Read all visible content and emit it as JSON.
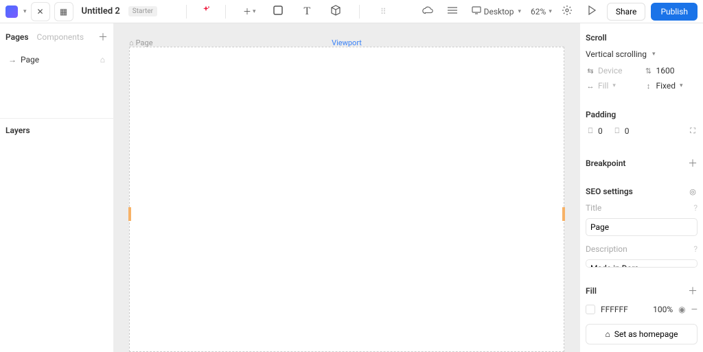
{
  "header": {
    "title": "Untitled 2",
    "plan_tag": "Starter",
    "device_label": "Desktop",
    "zoom": "62%",
    "share": "Share",
    "publish": "Publish"
  },
  "left": {
    "tab_pages": "Pages",
    "tab_components": "Components",
    "page_name": "Page",
    "layers_label": "Layers"
  },
  "canvas": {
    "page_label": "Page",
    "viewport_label": "Viewport"
  },
  "panel": {
    "scroll": {
      "title": "Scroll",
      "mode": "Vertical scrolling",
      "width_label": "Device",
      "height_value": "1600",
      "hfill_label": "Fill",
      "vmode": "Fixed"
    },
    "padding": {
      "title": "Padding",
      "left": "0",
      "top": "0"
    },
    "breakpoint": {
      "title": "Breakpoint"
    },
    "seo": {
      "title": "SEO settings",
      "title_label": "Title",
      "title_value": "Page",
      "desc_label": "Description",
      "desc_value": "Made in Dora"
    },
    "fill": {
      "title": "Fill",
      "hex": "FFFFFF",
      "opacity": "100%"
    },
    "set_home": "Set as homepage"
  }
}
